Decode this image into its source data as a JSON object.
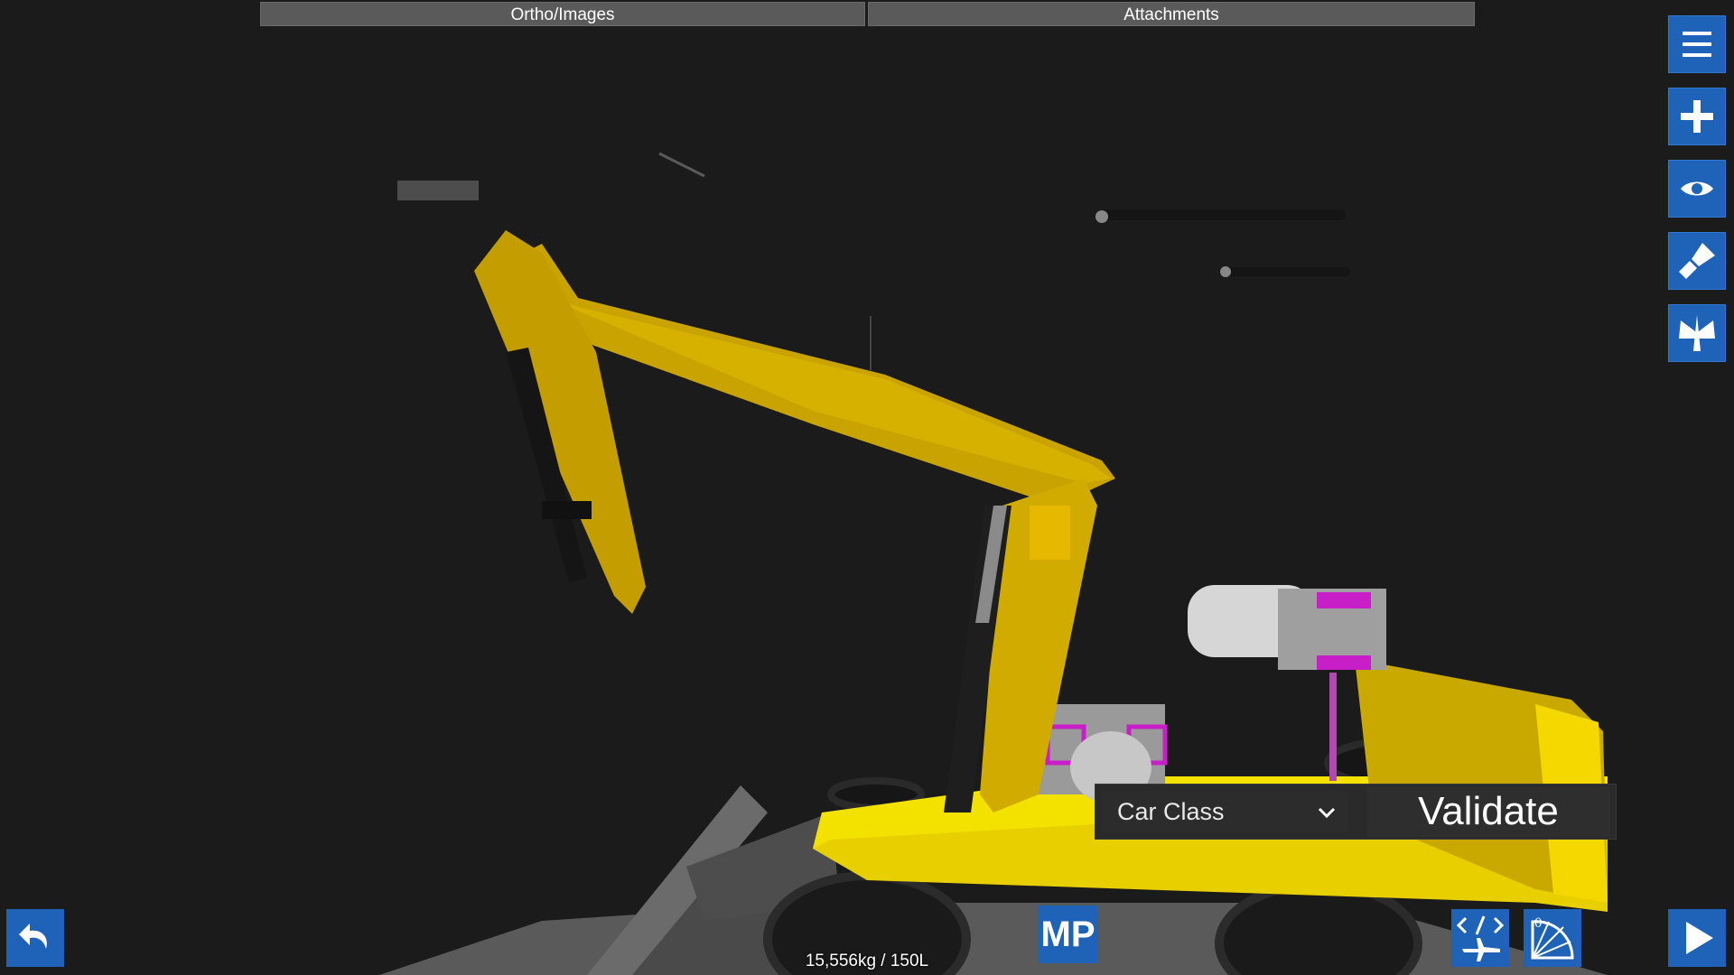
{
  "top_tabs": {
    "ortho_label": "Ortho/Images",
    "attachments_label": "Attachments"
  },
  "sidebar": {
    "icons": [
      "menu-icon",
      "plus-icon",
      "eye-icon",
      "paint-brush-icon",
      "wing-icon"
    ]
  },
  "bottom_bar": {
    "mp_label": "MP",
    "stats": "15,556kg / 150L"
  },
  "validate_panel": {
    "class_selected": "Car Class",
    "validate_label": "Validate"
  },
  "colors": {
    "accent": "#1e63b8",
    "background": "#1b1b1b",
    "vehicle_yellow": "#e8c400",
    "highlight_magenta": "#d21ed2"
  }
}
